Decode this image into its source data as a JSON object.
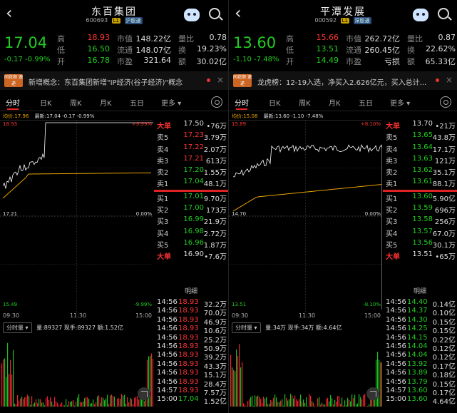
{
  "panels": [
    {
      "title": "东百集团",
      "code": "600693",
      "tag_l": "L1",
      "tag_b": "沪股通",
      "price": "17.04",
      "change": "-0.17",
      "change_pct": "-0.99%",
      "quote": [
        {
          "l1": "高",
          "v1": "18.93",
          "c1": "red",
          "l2": "市值",
          "v2": "148.22亿",
          "l3": "量比",
          "v3": "0.78"
        },
        {
          "l1": "低",
          "v1": "16.50",
          "c1": "green",
          "l2": "流通",
          "v2": "148.07亿",
          "l3": "换",
          "v3": "19.23%"
        },
        {
          "l1": "开",
          "v1": "16.78",
          "c1": "green",
          "l2": "市盈",
          "v2": "321.64",
          "l3": "额",
          "v3": "30.02亿"
        }
      ],
      "news_logo": "同花顺 速递",
      "news": "新增概念：东百集团新增\"IP经济(谷子经济)\"概念",
      "tabs": [
        "分时",
        "日K",
        "周K",
        "月K",
        "五日",
        "更多"
      ],
      "legend_avg": "均价:17.96",
      "legend_new": "最新:17.04 -0.17 -0.99%",
      "top_price": "18.93",
      "top_pct": "+9.99%",
      "mid_price": "17.21",
      "mid_pct": "0.00%",
      "bot_price": "15.49",
      "bot_pct": "-9.99%",
      "book_top": {
        "label": "大单",
        "price": "17.50",
        "vol": "•76万"
      },
      "asks": [
        {
          "label": "卖5",
          "price": "17.23",
          "vol": "3.79万"
        },
        {
          "label": "卖4",
          "price": "17.22",
          "vol": "2.07万"
        },
        {
          "label": "卖3",
          "price": "17.21",
          "vol": "613万"
        },
        {
          "label": "卖2",
          "price": "17.20",
          "vol": "1.55万"
        },
        {
          "label": "卖1",
          "price": "17.04",
          "vol": "48.1万"
        }
      ],
      "bids": [
        {
          "label": "买1",
          "price": "17.01",
          "vol": "9.70万"
        },
        {
          "label": "买2",
          "price": "17.00",
          "vol": "173万"
        },
        {
          "label": "买3",
          "price": "16.99",
          "vol": "21.9万"
        },
        {
          "label": "买4",
          "price": "16.98",
          "vol": "2.72万"
        },
        {
          "label": "买5",
          "price": "16.96",
          "vol": "1.87万"
        }
      ],
      "book_bot": {
        "label": "大单",
        "price": "16.90",
        "vol": "•7.6万"
      },
      "tick_header": "明细",
      "ticks": [
        {
          "t": "14:56",
          "p": "18.93",
          "v": "32.2万"
        },
        {
          "t": "14:56",
          "p": "18.93",
          "v": "70.0万"
        },
        {
          "t": "14:56",
          "p": "18.93",
          "v": "46.9万"
        },
        {
          "t": "14:56",
          "p": "18.93",
          "v": "10.6万"
        },
        {
          "t": "14:56",
          "p": "18.93",
          "v": "25.2万"
        },
        {
          "t": "14:56",
          "p": "18.93",
          "v": "50.9万"
        },
        {
          "t": "14:56",
          "p": "18.93",
          "v": "39.2万"
        },
        {
          "t": "14:56",
          "p": "18.93",
          "v": "43.3万"
        },
        {
          "t": "14:56",
          "p": "18.93",
          "v": "15.1万"
        },
        {
          "t": "14:56",
          "p": "18.93",
          "v": "28.4万"
        },
        {
          "t": "14:57",
          "p": "18.93",
          "v": "7.57万"
        },
        {
          "t": "15:00",
          "p": "17.04",
          "v": "1.52亿"
        }
      ],
      "time_axis": [
        "09:30",
        "11:30",
        "15:00"
      ],
      "vol_selector": "分时量",
      "vol_legend": "量:89327  现手:89327  额:1.52亿"
    },
    {
      "title": "平潭发展",
      "code": "000592",
      "tag_l": "L1",
      "tag_b": "深股通",
      "price": "13.60",
      "change": "-1.10",
      "change_pct": "-7.48%",
      "quote": [
        {
          "l1": "高",
          "v1": "15.66",
          "c1": "red",
          "l2": "市值",
          "v2": "262.72亿",
          "l3": "量比",
          "v3": "0.87"
        },
        {
          "l1": "低",
          "v1": "13.51",
          "c1": "green",
          "l2": "流通",
          "v2": "260.45亿",
          "l3": "换",
          "v3": "22.62%"
        },
        {
          "l1": "开",
          "v1": "14.49",
          "c1": "green",
          "l2": "市盈",
          "v2": "亏损",
          "l3": "额",
          "v3": "65.33亿"
        }
      ],
      "news_logo": "同花顺 速递",
      "news": "龙虎榜：12-19入选，净买入2.626亿元，买入总计...",
      "tabs": [
        "分时",
        "日K",
        "周K",
        "月K",
        "五日",
        "更多"
      ],
      "legend_avg": "均价:15.08",
      "legend_new": "最新:13.60 -1.10 -7.48%",
      "top_price": "15.89",
      "top_pct": "+8.10%",
      "mid_price": "14.70",
      "mid_pct": "0.00%",
      "bot_price": "13.51",
      "bot_pct": "-8.10%",
      "book_top": {
        "label": "大单",
        "price": "13.70",
        "vol": "•21万"
      },
      "asks": [
        {
          "label": "卖5",
          "price": "13.65",
          "vol": "43.8万"
        },
        {
          "label": "卖4",
          "price": "13.64",
          "vol": "17.1万"
        },
        {
          "label": "卖3",
          "price": "13.63",
          "vol": "121万"
        },
        {
          "label": "卖2",
          "price": "13.62",
          "vol": "35.1万"
        },
        {
          "label": "卖1",
          "price": "13.61",
          "vol": "88.1万"
        }
      ],
      "bids": [
        {
          "label": "买1",
          "price": "13.60",
          "vol": "5.90亿"
        },
        {
          "label": "买2",
          "price": "13.59",
          "vol": "696万"
        },
        {
          "label": "买3",
          "price": "13.58",
          "vol": "256万"
        },
        {
          "label": "买4",
          "price": "13.57",
          "vol": "67.0万"
        },
        {
          "label": "买5",
          "price": "13.56",
          "vol": "30.1万"
        }
      ],
      "book_bot": {
        "label": "大单",
        "price": "13.51",
        "vol": "•65万"
      },
      "tick_header": "明细",
      "ticks": [
        {
          "t": "14:56",
          "p": "14.40",
          "v": "0.14亿"
        },
        {
          "t": "14:56",
          "p": "14.37",
          "v": "0.10亿"
        },
        {
          "t": "14:56",
          "p": "14.30",
          "v": "0.15亿"
        },
        {
          "t": "14:56",
          "p": "14.25",
          "v": "0.15亿"
        },
        {
          "t": "14:56",
          "p": "14.15",
          "v": "0.22亿"
        },
        {
          "t": "14:56",
          "p": "14.04",
          "v": "0.12亿"
        },
        {
          "t": "14:56",
          "p": "14.04",
          "v": "0.12亿"
        },
        {
          "t": "14:56",
          "p": "13.92",
          "v": "0.17亿"
        },
        {
          "t": "14:56",
          "p": "13.89",
          "v": "0.18亿"
        },
        {
          "t": "14:56",
          "p": "13.79",
          "v": "0.15亿"
        },
        {
          "t": "14:57",
          "p": "13.60",
          "v": "0.17亿"
        },
        {
          "t": "15:00",
          "p": "13.60",
          "v": "4.64亿"
        }
      ],
      "time_axis": [
        "09:30",
        "11:30",
        "15:00"
      ],
      "vol_selector": "分时量",
      "vol_legend": "量:34万  现手:34万  额:4.64亿"
    }
  ],
  "colors": {
    "up": "#ff3333",
    "down": "#22cc22",
    "avg": "#e9a400",
    "line": "#ffffff"
  }
}
